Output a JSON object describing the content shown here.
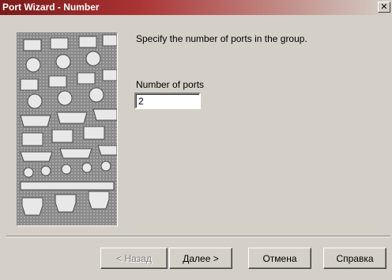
{
  "window": {
    "title": "Port Wizard - Number",
    "close_glyph": "✕"
  },
  "content": {
    "instruction": "Specify the number of ports in the group.",
    "ports_label": "Number of ports",
    "ports_value": "2"
  },
  "buttons": {
    "back": "< Назад",
    "next": "Далее >",
    "cancel": "Отмена",
    "help": "Справка"
  },
  "colors": {
    "title_start": "#7b1a1a",
    "face": "#d4d0c8"
  }
}
